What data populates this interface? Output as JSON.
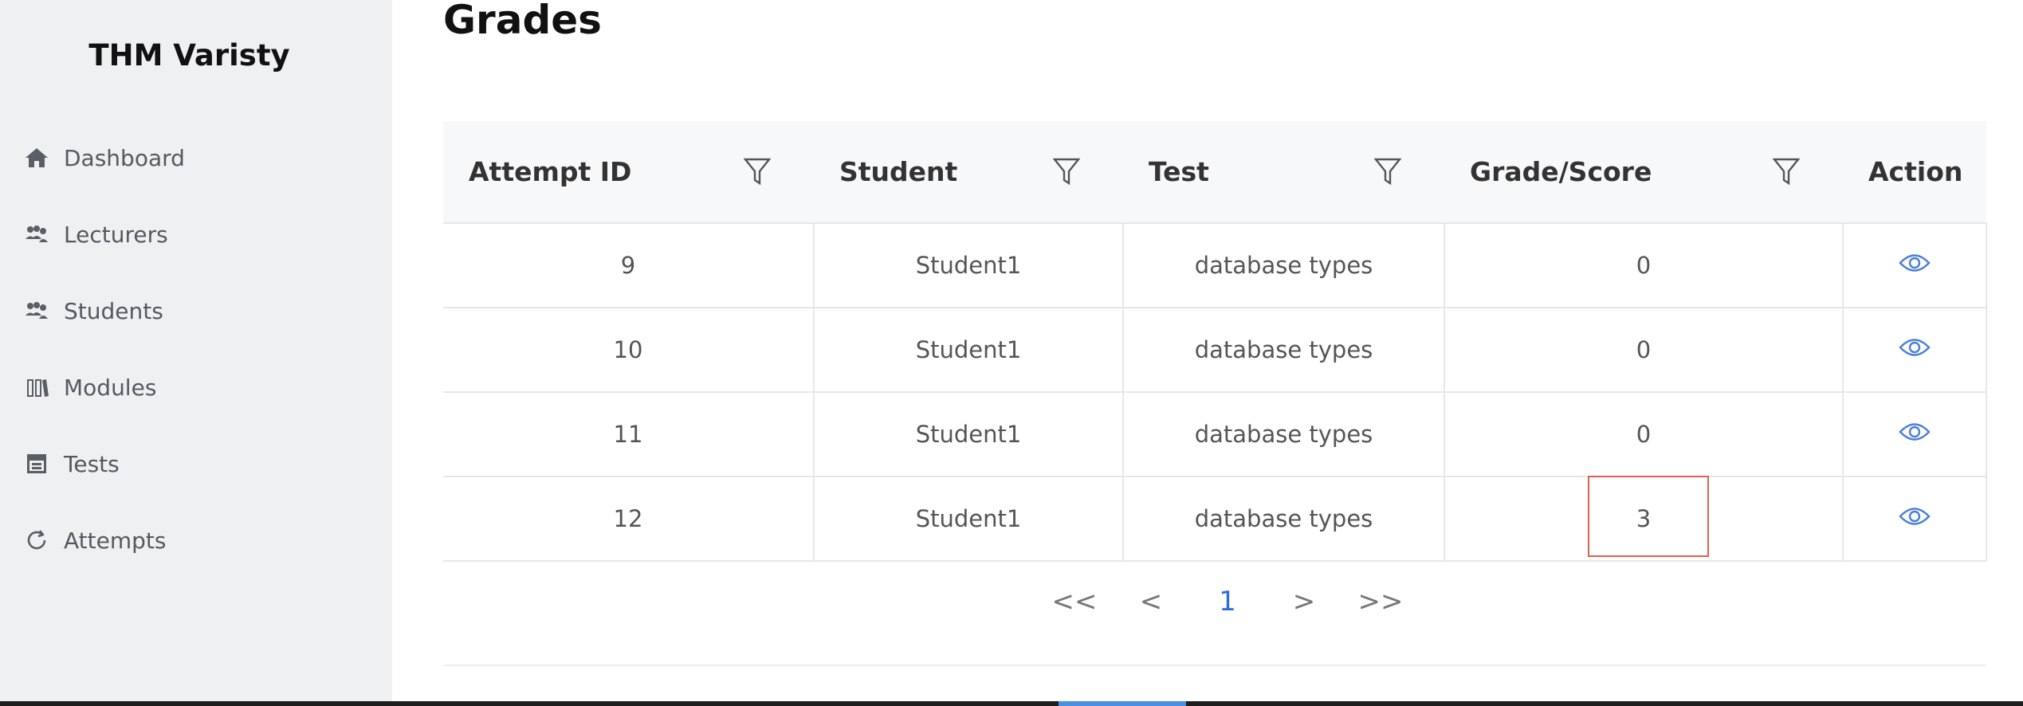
{
  "sidebar": {
    "brand": "THM Varisty",
    "items": [
      {
        "label": "Dashboard",
        "icon": "home-icon"
      },
      {
        "label": "Lecturers",
        "icon": "users-icon"
      },
      {
        "label": "Students",
        "icon": "users-icon"
      },
      {
        "label": "Modules",
        "icon": "books-icon"
      },
      {
        "label": "Tests",
        "icon": "calendar-icon"
      },
      {
        "label": "Attempts",
        "icon": "redo-icon"
      }
    ]
  },
  "page": {
    "title": "Grades"
  },
  "table": {
    "columns": [
      "Attempt ID",
      "Student",
      "Test",
      "Grade/Score",
      "Action"
    ],
    "rows": [
      {
        "attempt_id": "9",
        "student": "Student1",
        "test": "database types",
        "grade": "0"
      },
      {
        "attempt_id": "10",
        "student": "Student1",
        "test": "database types",
        "grade": "0"
      },
      {
        "attempt_id": "11",
        "student": "Student1",
        "test": "database types",
        "grade": "0"
      },
      {
        "attempt_id": "12",
        "student": "Student1",
        "test": "database types",
        "grade": "3"
      }
    ]
  },
  "pagination": {
    "first": "<<",
    "prev": "<",
    "current": "1",
    "next": ">",
    "last": ">>"
  },
  "colors": {
    "accent": "#2d6cdf",
    "eye": "#4a7fd9",
    "highlight": "#e06050",
    "sidebar_bg": "#eef0f2"
  }
}
